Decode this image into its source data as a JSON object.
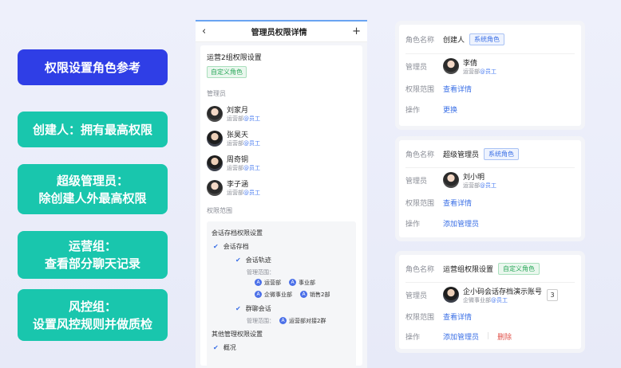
{
  "labels": [
    {
      "lines": [
        "权限设置角色参考"
      ]
    },
    {
      "lines": [
        "创建人：拥有最高权限"
      ]
    },
    {
      "lines": [
        "超级管理员：",
        "除创建人外最高权限"
      ]
    },
    {
      "lines": [
        "运营组：",
        "查看部分聊天记录"
      ]
    },
    {
      "lines": [
        "风控组：",
        "设置风控规则并做质检"
      ]
    }
  ],
  "phone": {
    "title": "管理员权限详情",
    "back_icon": "‹",
    "add_icon": "+",
    "group_title": "运营2组权限设置",
    "group_tag": "自定义角色",
    "admins_label": "管理员",
    "admins": [
      {
        "name": "刘家月",
        "dept": "运营部",
        "role": "@员工"
      },
      {
        "name": "张昊天",
        "dept": "运营部",
        "role": "@员工"
      },
      {
        "name": "周奇铜",
        "dept": "运营部",
        "role": "@员工"
      },
      {
        "name": "李子涵",
        "dept": "运营部",
        "role": "@员工"
      }
    ],
    "scope_label": "权限范围",
    "scope": {
      "archive_settings": "会话存档权限设置",
      "archive": "会话存档",
      "track": "会话轨迹",
      "range_label1": "管理范围：",
      "depts1": [
        "运营部",
        "事业部"
      ],
      "depts2": [
        "企微事业部",
        "销售2部"
      ],
      "group_chat": "群聊会话",
      "range_label2": "管理范围：",
      "depts3": [
        "运营部对接2群"
      ],
      "other_settings": "其他管理权限设置",
      "overview": "概况"
    }
  },
  "cards": [
    {
      "role_label": "角色名称",
      "role": "创建人",
      "tag": "系统角色",
      "admin_label": "管理员",
      "admin_name": "李倩",
      "admin_dept": "运营部",
      "admin_role": "@员工",
      "scope_label": "权限范围",
      "scope_link": "查看详情",
      "ops_label": "操作",
      "ops": [
        "更换"
      ]
    },
    {
      "role_label": "角色名称",
      "role": "超级管理员",
      "tag": "系统角色",
      "admin_label": "管理员",
      "admin_name": "刘小明",
      "admin_dept": "运营部",
      "admin_role": "@员工",
      "scope_label": "权限范围",
      "scope_link": "查看详情",
      "ops_label": "操作",
      "ops": [
        "添加管理员"
      ]
    },
    {
      "role_label": "角色名称",
      "role": "运营组权限设置",
      "tag": "自定义角色",
      "admin_label": "管理员",
      "admin_name": "企小码会话存档演示账号",
      "admin_dept": "企微事业部",
      "admin_role": "@员工",
      "admin_count": "3",
      "scope_label": "权限范围",
      "scope_link": "查看详情",
      "ops_label": "操作",
      "ops": [
        "添加管理员",
        "删除"
      ]
    }
  ]
}
